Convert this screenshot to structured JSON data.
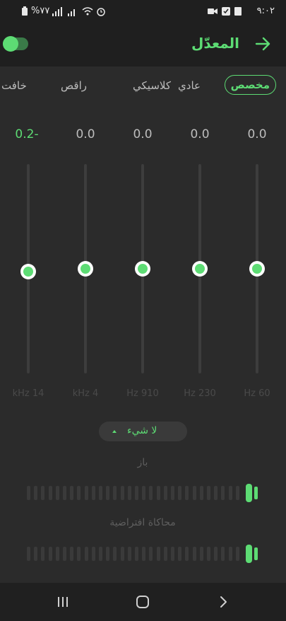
{
  "status_bar": {
    "time": "٩:٠٢",
    "battery": "%٧٧"
  },
  "header": {
    "title": "المعدّل",
    "power_on": true
  },
  "presets": [
    {
      "label": "مخصص",
      "active": true
    },
    {
      "label": "عادي",
      "active": false
    },
    {
      "label": "كلاسيكي",
      "active": false
    },
    {
      "label": "راقص",
      "active": false
    },
    {
      "label": "خافت",
      "active": false
    }
  ],
  "bands": [
    {
      "freq": "kHz 14",
      "value": "0.2-",
      "level": -0.2
    },
    {
      "freq": "kHz 4",
      "value": "0.0",
      "level": 0.0
    },
    {
      "freq": "Hz 910",
      "value": "0.0",
      "level": 0.0
    },
    {
      "freq": "Hz 230",
      "value": "0.0",
      "level": 0.0
    },
    {
      "freq": "Hz 60",
      "value": "0.0",
      "level": 0.0
    }
  ],
  "reverb": {
    "label": "لا شيء"
  },
  "bass": {
    "label": "باز",
    "level": 1.0
  },
  "virtualizer": {
    "label": "محاكاة افتراضية",
    "level": 1.0
  },
  "colors": {
    "accent": "#5ddc74",
    "background": "#2b2b2b",
    "bar": "#1f1f1f"
  },
  "nav": {
    "recent": "recent-apps-icon",
    "home": "home-icon",
    "back": "back-icon"
  }
}
